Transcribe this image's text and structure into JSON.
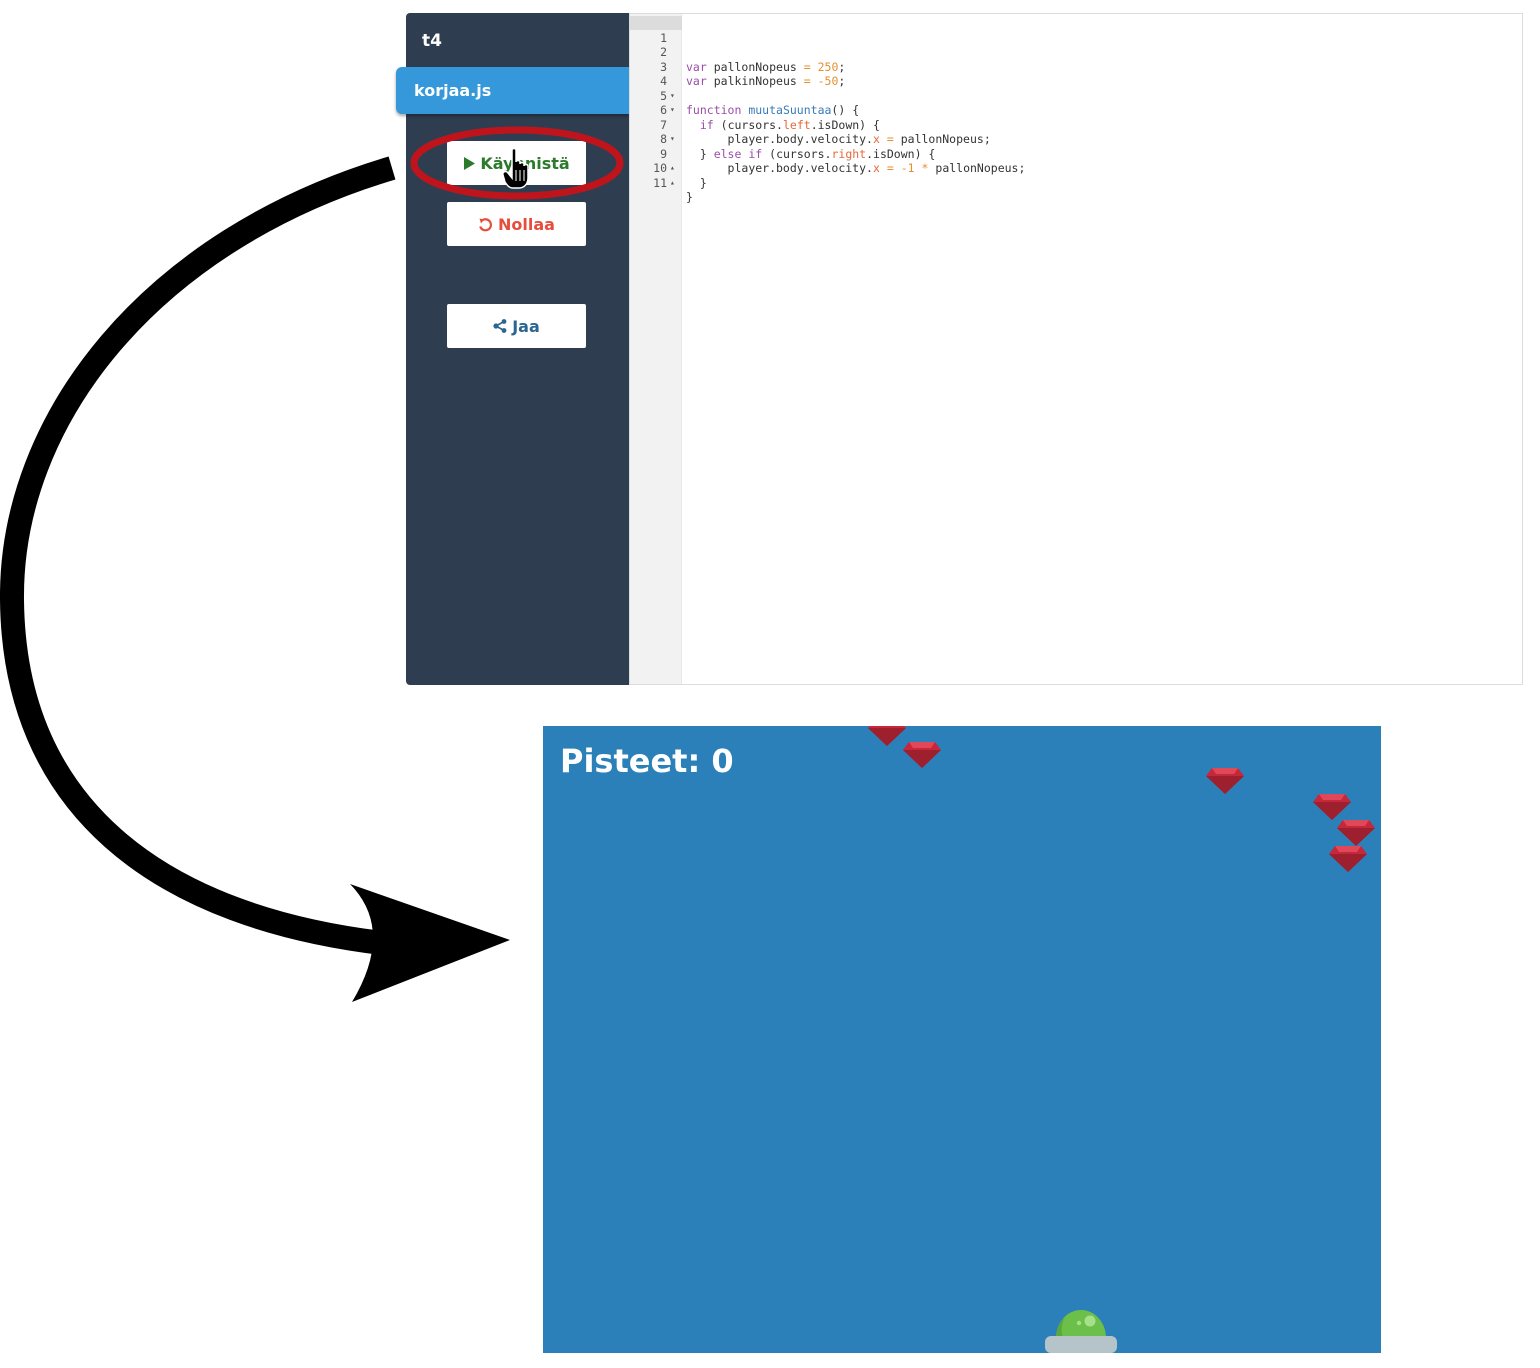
{
  "sidebar": {
    "project_title": "t4",
    "file_tab": "korjaa.js",
    "buttons": {
      "start": "Käynnistä",
      "reset": "Nollaa",
      "share": "Jaa"
    }
  },
  "editor": {
    "lines": [
      {
        "n": "1",
        "fold": ""
      },
      {
        "n": "2",
        "fold": ""
      },
      {
        "n": "3",
        "fold": ""
      },
      {
        "n": "4",
        "fold": "▾"
      },
      {
        "n": "5",
        "fold": "▾"
      },
      {
        "n": "6",
        "fold": ""
      },
      {
        "n": "7",
        "fold": "▾"
      },
      {
        "n": "8",
        "fold": ""
      },
      {
        "n": "9",
        "fold": "▴"
      },
      {
        "n": "10",
        "fold": "▴"
      },
      {
        "n": "11",
        "fold": ""
      }
    ],
    "tokens": {
      "var": "var",
      "function": "function",
      "if": "if",
      "else": "else",
      "pallonNopeus": "pallonNopeus",
      "palkinNopeus": "palkinNopeus",
      "val250": "250",
      "valMinus50": "-50",
      "valMinus1": "-1",
      "fname": "muutaSuuntaa",
      "cursors": "cursors",
      "left": "left",
      "right": "right",
      "isDown": "isDown",
      "player_body_velocity": "player.body.velocity",
      "x": "x",
      "eq": "=",
      "star": "*"
    }
  },
  "game": {
    "score_label": "Pisteet: 0"
  },
  "colors": {
    "sidebar_bg": "#2e3e50",
    "tab_bg": "#3498db",
    "game_bg": "#2b80b9",
    "annotation_ring": "#c0141c",
    "gem": "#c4283a",
    "player": "#6cc04a"
  },
  "icons": {
    "start": "play-icon",
    "reset": "undo-icon",
    "share": "share-icon",
    "cursor": "hand-pointer-icon"
  }
}
